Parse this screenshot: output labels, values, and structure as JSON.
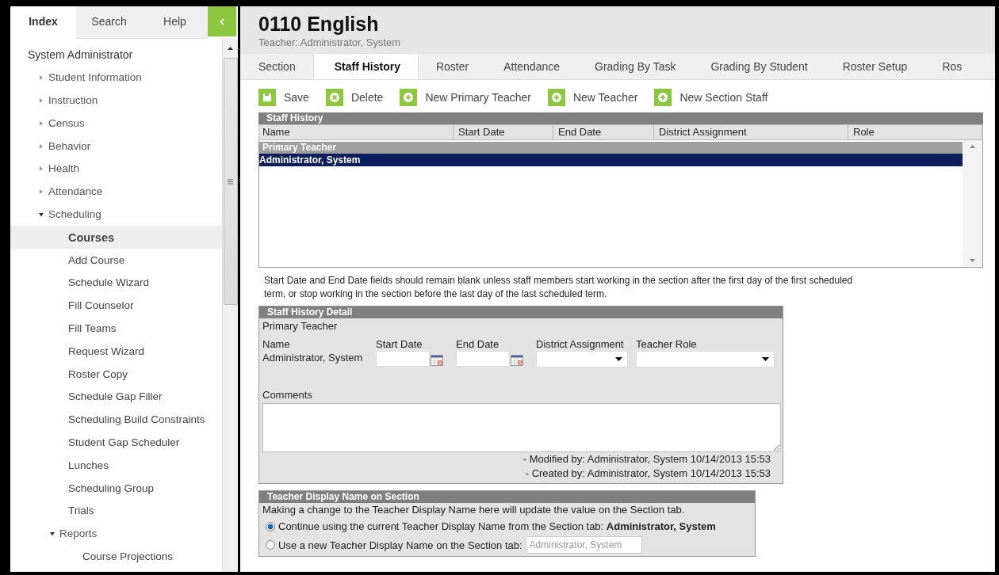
{
  "sidebar": {
    "tabs": [
      {
        "label": "Index",
        "selected": true
      },
      {
        "label": "Search",
        "selected": false
      },
      {
        "label": "Help",
        "selected": false
      }
    ],
    "tree": [
      {
        "label": "System Administrator",
        "kind": "root",
        "selected": false,
        "children": [
          {
            "label": "Student Information",
            "kind": "folder",
            "expanded": false,
            "selected": false
          },
          {
            "label": "Instruction",
            "kind": "folder",
            "expanded": false,
            "selected": false
          },
          {
            "label": "Census",
            "kind": "folder",
            "expanded": false,
            "selected": false
          },
          {
            "label": "Behavior",
            "kind": "folder",
            "expanded": false,
            "selected": false
          },
          {
            "label": "Health",
            "kind": "folder",
            "expanded": false,
            "selected": false
          },
          {
            "label": "Attendance",
            "kind": "folder",
            "expanded": false,
            "selected": false
          },
          {
            "label": "Scheduling",
            "kind": "folder",
            "expanded": true,
            "selected": false,
            "children": [
              {
                "label": "Courses",
                "kind": "leaf",
                "selected": true
              },
              {
                "label": "Add Course",
                "kind": "leaf",
                "selected": false
              },
              {
                "label": "Schedule Wizard",
                "kind": "leaf",
                "selected": false
              },
              {
                "label": "Fill Counselor",
                "kind": "leaf",
                "selected": false
              },
              {
                "label": "Fill Teams",
                "kind": "leaf",
                "selected": false
              },
              {
                "label": "Request Wizard",
                "kind": "leaf",
                "selected": false
              },
              {
                "label": "Roster Copy",
                "kind": "leaf",
                "selected": false
              },
              {
                "label": "Schedule Gap Filler",
                "kind": "leaf",
                "selected": false
              },
              {
                "label": "Scheduling Build Constraints",
                "kind": "leaf",
                "selected": false
              },
              {
                "label": "Student Gap Scheduler",
                "kind": "leaf",
                "selected": false
              },
              {
                "label": "Lunches",
                "kind": "leaf",
                "selected": false
              },
              {
                "label": "Scheduling Group",
                "kind": "leaf",
                "selected": false
              },
              {
                "label": "Trials",
                "kind": "leaf",
                "selected": false
              },
              {
                "label": "Reports",
                "kind": "folder",
                "expanded": true,
                "selected": false,
                "children": [
                  {
                    "label": "Course Projections",
                    "kind": "leaf",
                    "selected": false
                  }
                ]
              }
            ]
          }
        ]
      }
    ]
  },
  "header": {
    "title": "0110 English",
    "subtitle": "Teacher: Administrator, System"
  },
  "tabs": [
    {
      "label": "Section",
      "selected": false
    },
    {
      "label": "Staff History",
      "selected": true
    },
    {
      "label": "Roster",
      "selected": false
    },
    {
      "label": "Attendance",
      "selected": false
    },
    {
      "label": "Grading By Task",
      "selected": false
    },
    {
      "label": "Grading By Student",
      "selected": false
    },
    {
      "label": "Roster Setup",
      "selected": false
    },
    {
      "label": "Ros",
      "selected": false
    }
  ],
  "toolbar": [
    {
      "label": "Save",
      "kind": "save"
    },
    {
      "label": "Delete",
      "kind": "delete"
    },
    {
      "label": "New Primary Teacher",
      "kind": "add"
    },
    {
      "label": "New Teacher",
      "kind": "add"
    },
    {
      "label": "New Section Staff",
      "kind": "add"
    }
  ],
  "staff_history": {
    "title": "Staff History",
    "columns": [
      "Name",
      "Start Date",
      "End Date",
      "District Assignment",
      "Role"
    ],
    "groups": [
      {
        "label": "Primary Teacher",
        "rows": [
          {
            "name": "Administrator, System",
            "selected": true
          }
        ]
      }
    ]
  },
  "note": "Start Date and End Date fields should remain blank unless staff members start working in the section after the first day of the first scheduled term, or stop working in the section before the last day of the last scheduled term.",
  "detail": {
    "title": "Staff History Detail",
    "subtitle": "Primary Teacher",
    "name_label": "Name",
    "name_value": "Administrator, System",
    "start_date_label": "Start Date",
    "end_date_label": "End Date",
    "district_assignment_label": "District Assignment",
    "teacher_role_label": "Teacher Role",
    "comments_label": "Comments",
    "modified": "- Modified by: Administrator, System 10/14/2013 15:53",
    "created": "- Created by: Administrator, System 10/14/2013 15:53"
  },
  "display_name": {
    "title": "Teacher Display Name on Section",
    "description": "Making a change to the Teacher Display Name here will update the value on the Section tab.",
    "options": [
      {
        "label": "Continue using the current Teacher Display Name from the Section tab: **Administrator, System**",
        "selected": true
      },
      {
        "label": "Use a new Teacher Display Name on the Section tab:",
        "selected": false,
        "placeholder": "Administrator, System"
      }
    ]
  }
}
